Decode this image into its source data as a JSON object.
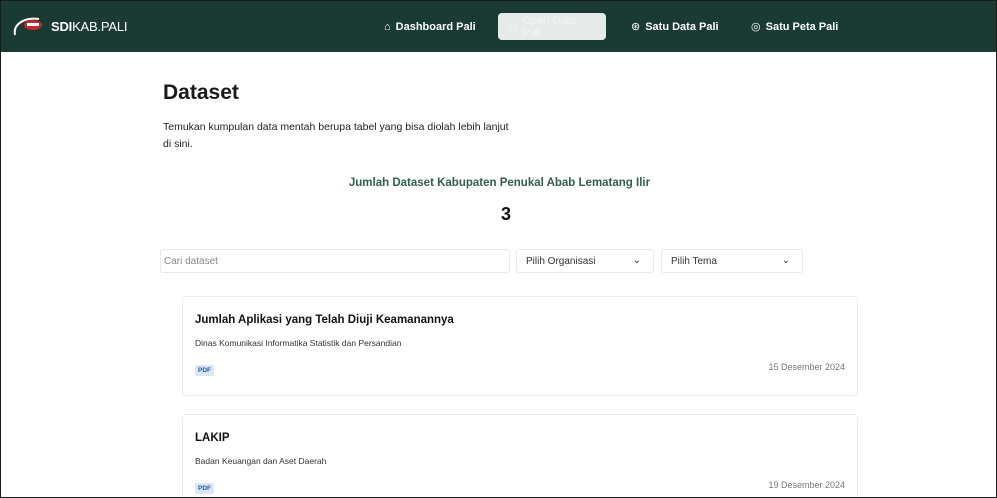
{
  "header": {
    "logo_bold": "SDI",
    "logo_rest": "KAB.PALI",
    "nav": [
      {
        "icon": "⌂",
        "label": "Dashboard Pali"
      },
      {
        "icon": "◎",
        "label": "Open Data Pali"
      },
      {
        "icon": "⊛",
        "label": "Satu Data Pali"
      },
      {
        "icon": "◎",
        "label": "Satu Peta Pali"
      }
    ]
  },
  "page": {
    "title": "Dataset",
    "description": "Temukan kumpulan data mentah berupa tabel yang bisa diolah lebih lanjut di sini.",
    "count_title": "Jumlah Dataset Kabupaten Penukal Abab Lematang Ilir",
    "count_value": "3"
  },
  "filters": {
    "search_placeholder": "Cari dataset",
    "organisasi": "Pilih Organisasi",
    "tema": "Pilih Tema"
  },
  "datasets": [
    {
      "title": "Jumlah Aplikasi yang Telah Diuji Keamanannya",
      "organization": "Dinas Komunikasi Informatika Statistik dan Persandian",
      "format": "PDF",
      "date": "15 Desember 2024"
    },
    {
      "title": "LAKIP",
      "organization": "Badan Keuangan dan Aset Daerah",
      "format": "PDF",
      "date": "19 Desember 2024"
    }
  ],
  "colors": {
    "navbar_bg": "#1a3b33",
    "count_title": "#2f5f4f",
    "badge_bg": "#dbe6f7",
    "badge_text": "#2a5aa8"
  }
}
